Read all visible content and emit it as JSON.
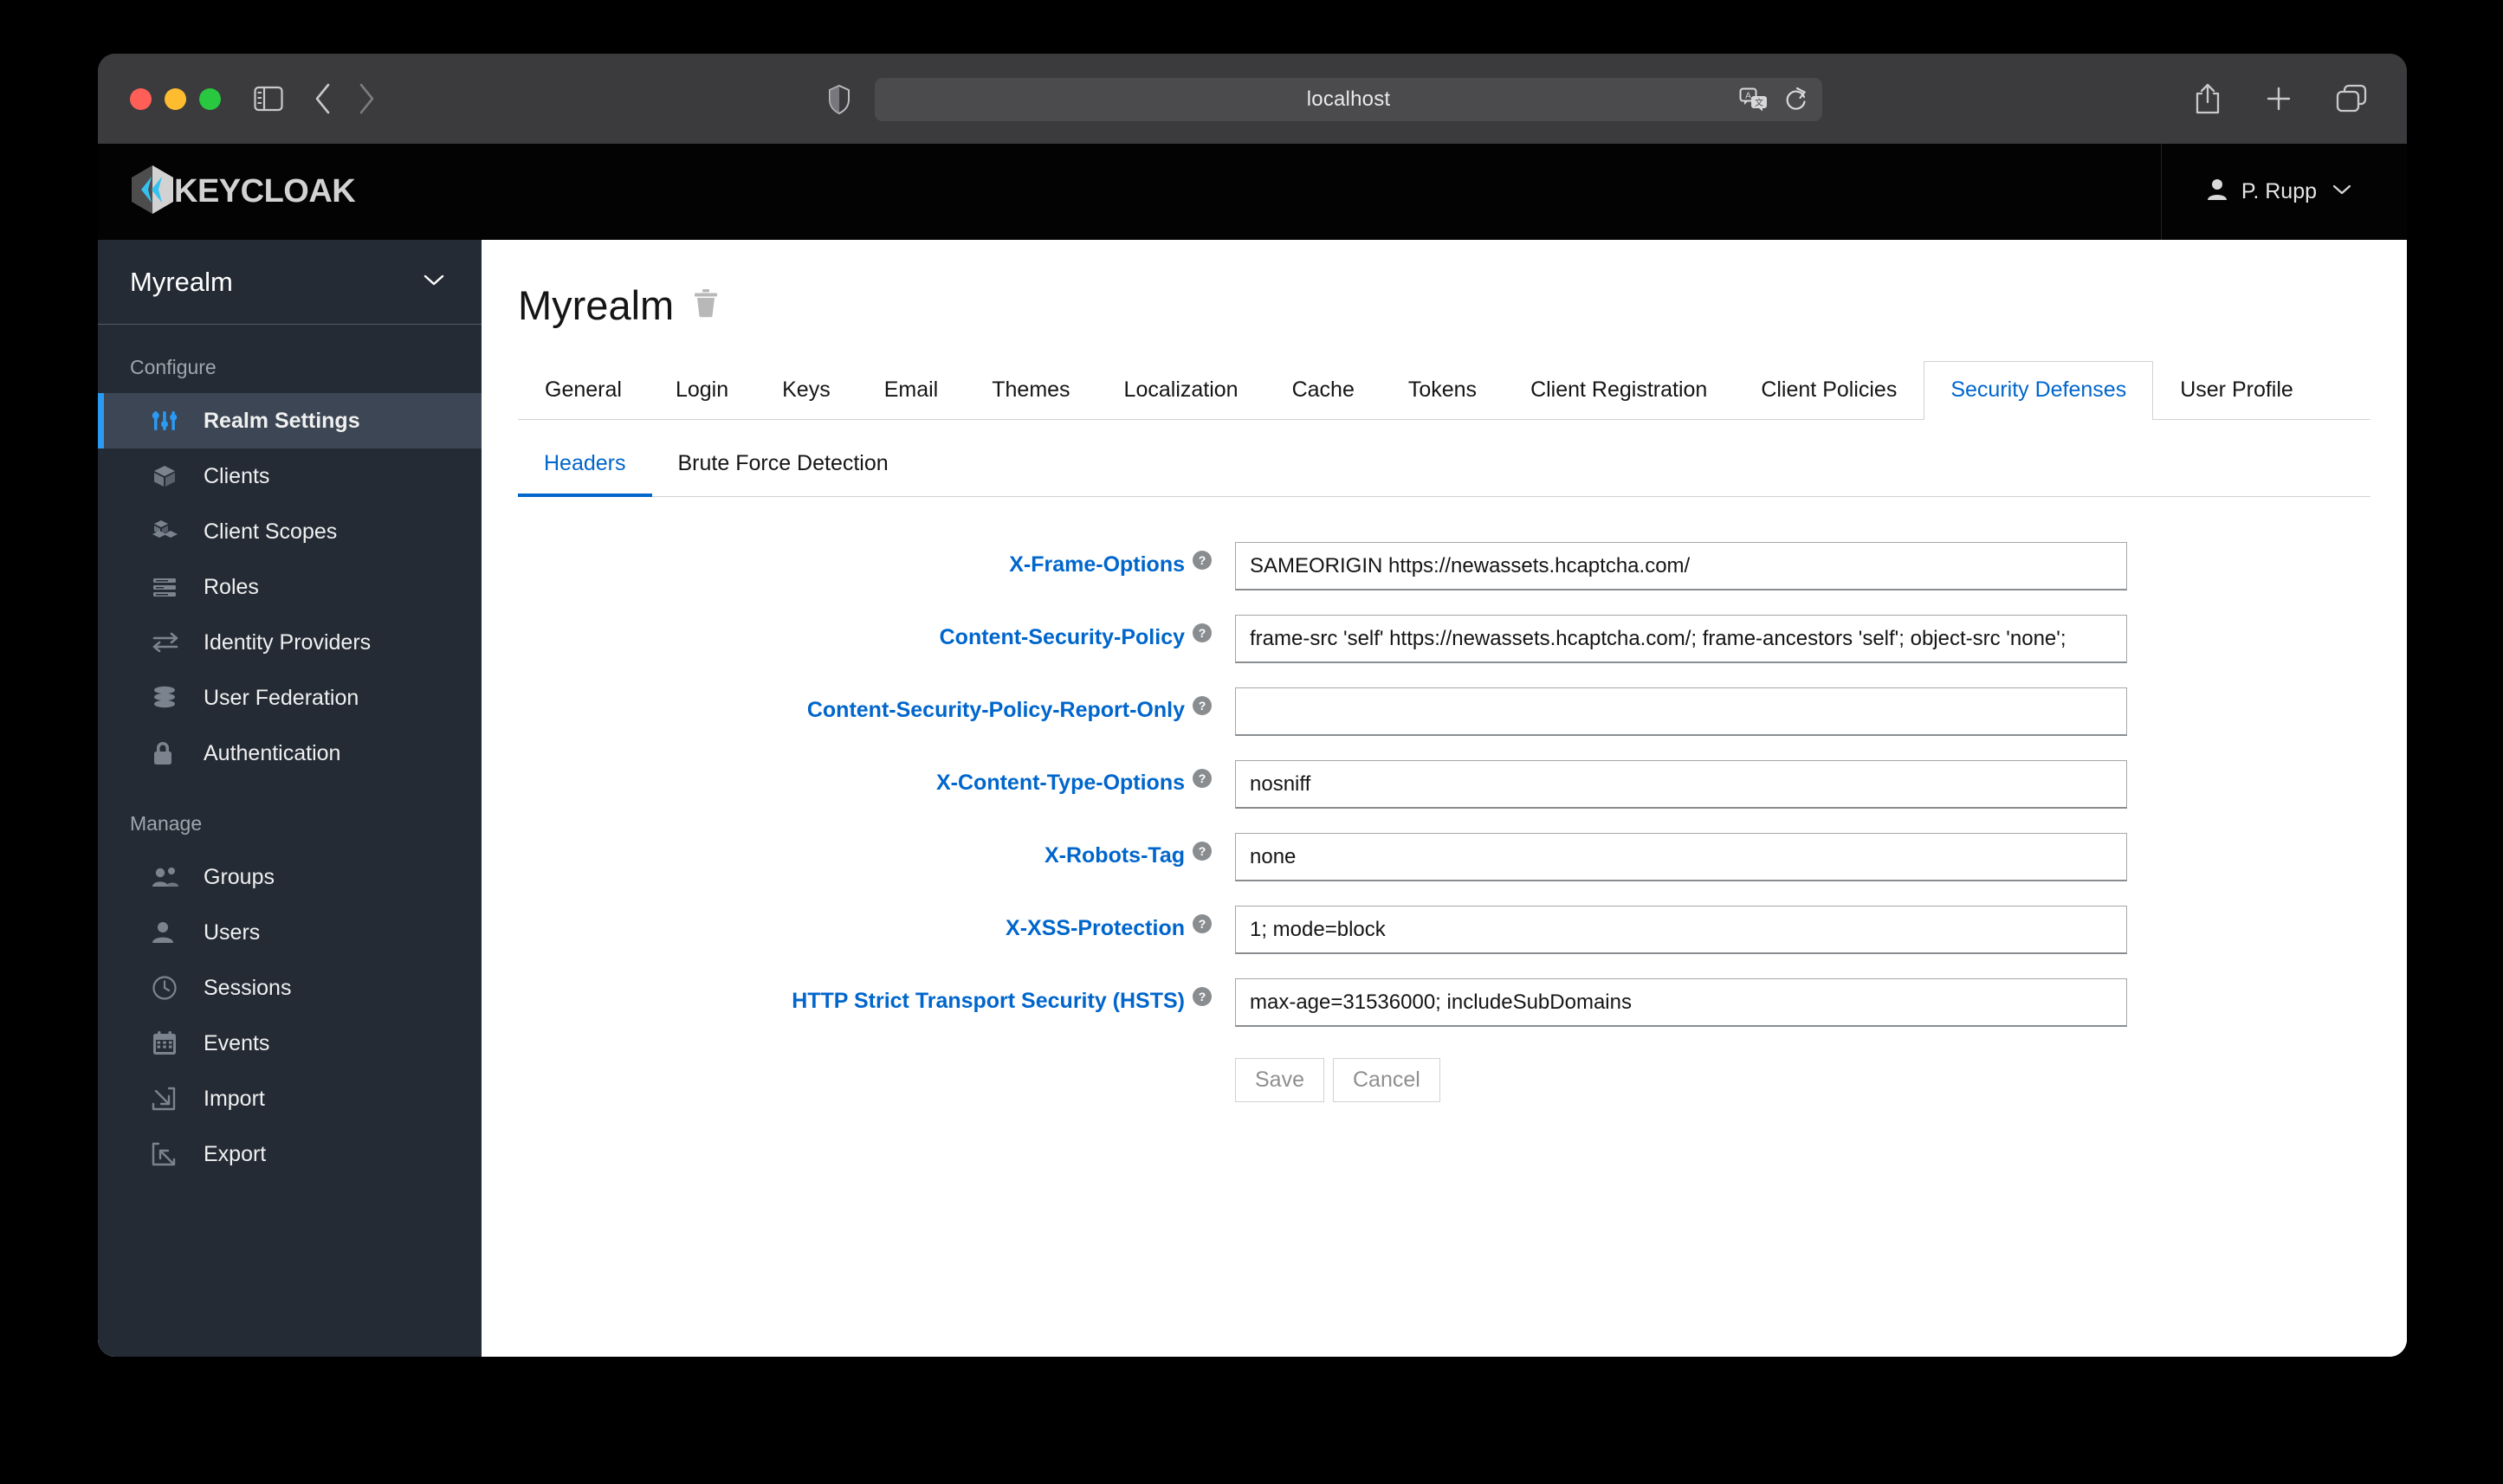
{
  "browser": {
    "url": "localhost",
    "traffic_lights": [
      "close",
      "minimize",
      "zoom"
    ],
    "icons": {
      "sidebar_toggle": "sidebar-toggle-icon",
      "back": "back-arrow-icon",
      "forward": "forward-arrow-icon",
      "shield": "shield-icon",
      "translate": "translate-icon",
      "reload": "reload-icon",
      "share": "share-icon",
      "new_tab": "plus-icon",
      "tab_overview": "tab-overview-icon"
    }
  },
  "masthead": {
    "brand": "KEYCLOAK",
    "brand_icon": "keycloak-logo-icon",
    "user": "P. Rupp",
    "user_icon": "user-avatar-icon",
    "caret_icon": "chevron-down-icon"
  },
  "sidebar": {
    "realm": "Myrealm",
    "sections": [
      {
        "title": "Configure",
        "items": [
          {
            "label": "Realm Settings",
            "icon": "sliders-icon",
            "active": true
          },
          {
            "label": "Clients",
            "icon": "cube-icon",
            "active": false
          },
          {
            "label": "Client Scopes",
            "icon": "cubes-icon",
            "active": false
          },
          {
            "label": "Roles",
            "icon": "list-icon",
            "active": false
          },
          {
            "label": "Identity Providers",
            "icon": "exchange-arrows-icon",
            "active": false
          },
          {
            "label": "User Federation",
            "icon": "database-icon",
            "active": false
          },
          {
            "label": "Authentication",
            "icon": "lock-icon",
            "active": false
          }
        ]
      },
      {
        "title": "Manage",
        "items": [
          {
            "label": "Groups",
            "icon": "users-icon",
            "active": false
          },
          {
            "label": "Users",
            "icon": "user-icon",
            "active": false
          },
          {
            "label": "Sessions",
            "icon": "clock-icon",
            "active": false
          },
          {
            "label": "Events",
            "icon": "calendar-icon",
            "active": false
          },
          {
            "label": "Import",
            "icon": "import-arrow-icon",
            "active": false
          },
          {
            "label": "Export",
            "icon": "export-arrow-icon",
            "active": false
          }
        ]
      }
    ]
  },
  "page": {
    "title": "Myrealm",
    "delete_icon": "trash-icon",
    "primary_tabs": [
      {
        "label": "General",
        "active": false
      },
      {
        "label": "Login",
        "active": false
      },
      {
        "label": "Keys",
        "active": false
      },
      {
        "label": "Email",
        "active": false
      },
      {
        "label": "Themes",
        "active": false
      },
      {
        "label": "Localization",
        "active": false
      },
      {
        "label": "Cache",
        "active": false
      },
      {
        "label": "Tokens",
        "active": false
      },
      {
        "label": "Client Registration",
        "active": false
      },
      {
        "label": "Client Policies",
        "active": false
      },
      {
        "label": "Security Defenses",
        "active": true
      },
      {
        "label": "User Profile",
        "active": false
      }
    ],
    "secondary_tabs": [
      {
        "label": "Headers",
        "active": true
      },
      {
        "label": "Brute Force Detection",
        "active": false
      }
    ]
  },
  "form": {
    "fields": [
      {
        "label": "X-Frame-Options",
        "value": "SAMEORIGIN https://newassets.hcaptcha.com/",
        "placeholder": "",
        "help_icon": "help-circle-icon"
      },
      {
        "label": "Content-Security-Policy",
        "value": "frame-src 'self' https://newassets.hcaptcha.com/; frame-ancestors 'self'; object-src 'none';",
        "placeholder": "",
        "help_icon": "help-circle-icon"
      },
      {
        "label": "Content-Security-Policy-Report-Only",
        "value": "",
        "placeholder": "",
        "help_icon": "help-circle-icon"
      },
      {
        "label": "X-Content-Type-Options",
        "value": "nosniff",
        "placeholder": "",
        "help_icon": "help-circle-icon"
      },
      {
        "label": "X-Robots-Tag",
        "value": "none",
        "placeholder": "",
        "help_icon": "help-circle-icon"
      },
      {
        "label": "X-XSS-Protection",
        "value": "1; mode=block",
        "placeholder": "",
        "help_icon": "help-circle-icon"
      },
      {
        "label": "HTTP Strict Transport Security (HSTS)",
        "value": "max-age=31536000; includeSubDomains",
        "placeholder": "",
        "help_icon": "help-circle-icon"
      }
    ],
    "save_label": "Save",
    "cancel_label": "Cancel"
  },
  "colors": {
    "accent_blue": "#0066cc",
    "sidebar_bg": "#242b35",
    "masthead_bg": "#030303",
    "active_nav_blue": "#2b9af3"
  }
}
